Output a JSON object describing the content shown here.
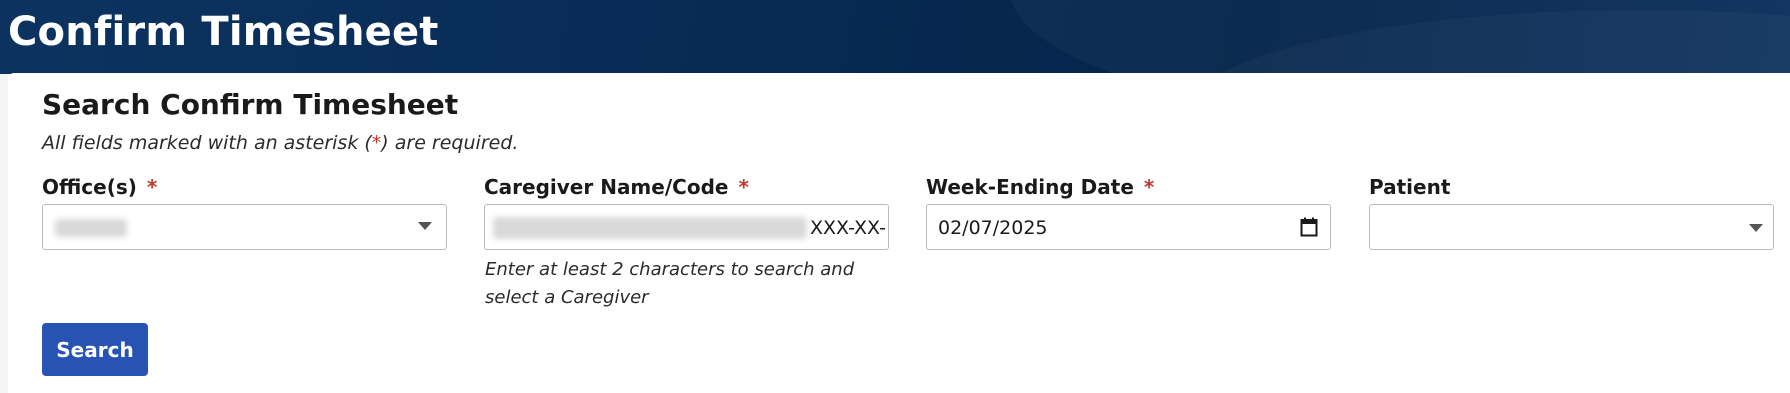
{
  "header": {
    "title": "Confirm Timesheet"
  },
  "form": {
    "title": "Search Confirm Timesheet",
    "required_note_prefix": "All fields marked with an asterisk (",
    "required_note_star": "*",
    "required_note_suffix": ") are required.",
    "offices": {
      "label": "Office(s)",
      "required_marker": "*",
      "value": ""
    },
    "caregiver": {
      "label": "Caregiver Name/Code",
      "required_marker": "*",
      "value_visible_suffix": "XXX-XX-",
      "help": "Enter at least 2 characters to search and select a Caregiver"
    },
    "week_ending": {
      "label": "Week-Ending Date",
      "required_marker": "*",
      "value": "02/07/2025"
    },
    "patient": {
      "label": "Patient",
      "value": ""
    },
    "search_label": "Search"
  },
  "colors": {
    "banner": "#072a52",
    "primary_button": "#2754b3",
    "required": "#c0392b"
  },
  "icons": {
    "dropdown": "chevron-down-icon",
    "date_picker": "calendar-icon"
  }
}
